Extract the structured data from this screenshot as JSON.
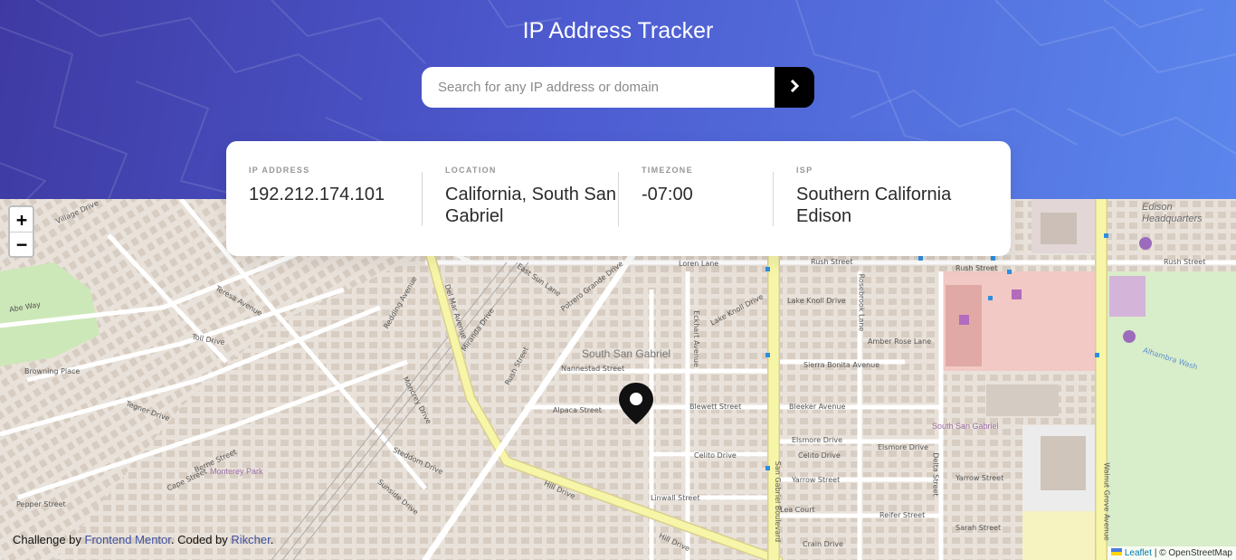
{
  "header": {
    "title": "IP Address Tracker",
    "search_placeholder": "Search for any IP address or domain",
    "search_value": "",
    "submit_icon": "chevron-right-icon"
  },
  "info": {
    "ip": {
      "label": "IP ADDRESS",
      "value": "192.212.174.101"
    },
    "location": {
      "label": "LOCATION",
      "value": "California, South San Gabriel"
    },
    "timezone": {
      "label": "TIMEZONE",
      "value": "-07:00"
    },
    "isp": {
      "label": "ISP",
      "value": "Southern California Edison"
    }
  },
  "map": {
    "zoom_in": "+",
    "zoom_out": "−",
    "area_labels": {
      "south_san_gabriel": "South San Gabriel",
      "monterey_park": "Monterey Park",
      "south_san_gabriel_small": "South San Gabriel",
      "edison_hq": "Edison Headquarters",
      "alhambra_wash": "Alhambra Wash"
    },
    "streets": {
      "rush_1": "Rush Street",
      "rush_2": "Rush Street",
      "rush_3": "Rush Street",
      "loren": "Loren Lane",
      "east_sun": "East Sun Lane",
      "potrero": "Potrero Grande Drive",
      "lake_knoll_dr": "Lake Knoll Drive",
      "lake_knoll": "Lake Knoll Drive",
      "amber_rose": "Amber Rose Lane",
      "sierra_bonita": "Sierra Bonita Avenue",
      "nannestad": "Nannestad Street",
      "alpaca": "Alpaca Street",
      "blewett": "Blewett Street",
      "bleeker": "Bleeker Avenue",
      "elsmore_dr": "Elsmore Drive",
      "elsmore_dr2": "Elsmore Drive",
      "celito": "Celito Drive",
      "celito2": "Celito Drive",
      "yarrow": "Yarrow Street",
      "yarrow2": "Yarrow Street",
      "linwall": "Linwall Street",
      "lea_court": "Lea Court",
      "reifer": "Reifer Street",
      "sarah": "Sarah Street",
      "crain": "Crain Drive",
      "hill_drive": "Hill Drive",
      "hill_drive2": "Hill Drive",
      "teresa": "Teresa Avenue",
      "abe": "Abe Way",
      "toll": "Toll Drive",
      "browning": "Browning Place",
      "tegner": "Tegner Drive",
      "berne": "Berne Street",
      "cape": "Cape Street",
      "pepper": "Pepper Street",
      "steddom": "Steddom Drive",
      "sunside": "Sunside Drive",
      "del_mar": "Del Mar Avenue",
      "san_gabriel_blvd": "San Gabriel Boulevard",
      "delta": "Delta Street",
      "walnut_grove": "Walnut Grove Avenue",
      "rosebrook": "Rosebrook Lane",
      "eckhart": "Eckhart Avenue",
      "miranda": "Miranda Drive",
      "rush_st_v": "Rush Street",
      "redding": "Redding Avenue",
      "moncrey": "Moncrey Drive",
      "village": "Village Drive"
    }
  },
  "footer": {
    "challenge_prefix": "Challenge by ",
    "challenge_link": "Frontend Mentor",
    "coded_prefix": ". Coded by ",
    "coded_link": "Rikcher",
    "suffix": ".",
    "leaflet": "Leaflet",
    "osm": "| © OpenStreetMap"
  },
  "colors": {
    "header_start": "#3f3aa3",
    "header_end": "#5b86ec",
    "main_road": "#f7f7a6",
    "road_border": "#d9cf8f",
    "buildings": "#d9cfc4",
    "park": "#c8e6b0",
    "commercial": "#f3c4c0"
  }
}
